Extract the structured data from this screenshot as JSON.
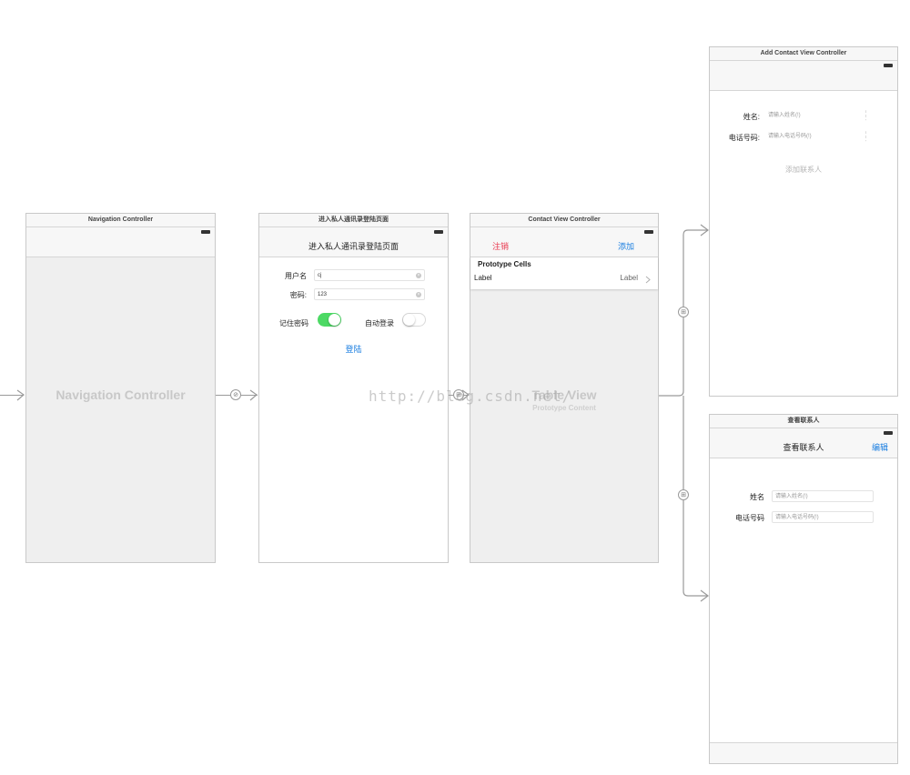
{
  "scenes": {
    "nav": {
      "title": "Navigation Controller",
      "center_label": "Navigation Controller"
    },
    "login": {
      "title": "进入私人通讯录登陆页面",
      "nav_title": "进入私人通讯录登陆页面",
      "username_label": "用户名",
      "username_value": "cj",
      "password_label": "密码:",
      "password_value": "123",
      "remember_label": "记住密码",
      "autologin_label": "自动登录",
      "login_button": "登陆"
    },
    "contacts": {
      "title": "Contact View Controller",
      "left_button": "注销",
      "right_button": "添加",
      "section_header": "Prototype Cells",
      "cell_label": "Label",
      "cell_detail": "Label",
      "center_label": "Table View",
      "center_sublabel": "Prototype Content"
    },
    "add": {
      "title": "Add Contact View Controller",
      "name_label": "姓名:",
      "name_placeholder": "请输入姓名(!)",
      "phone_label": "电话号码:",
      "phone_placeholder": "请输入电话号码(!)",
      "add_button": "添加联系人"
    },
    "view": {
      "title": "查看联系人",
      "nav_title": "查看联系人",
      "edit_button": "编辑",
      "name_label": "姓名",
      "name_placeholder": "请输入姓名(!)",
      "phone_label": "电话号码",
      "phone_placeholder": "请输入电话号码(!)"
    }
  },
  "watermark": "http://blog.csdn.net/",
  "colors": {
    "toggle_on": "#4cd964",
    "tint_blue": "#1a7ee0",
    "tint_red": "#e8384f"
  },
  "icons": {
    "segue": "segue-icon",
    "chevron": "chevron-right-icon",
    "arrow": "arrow-right-icon"
  }
}
